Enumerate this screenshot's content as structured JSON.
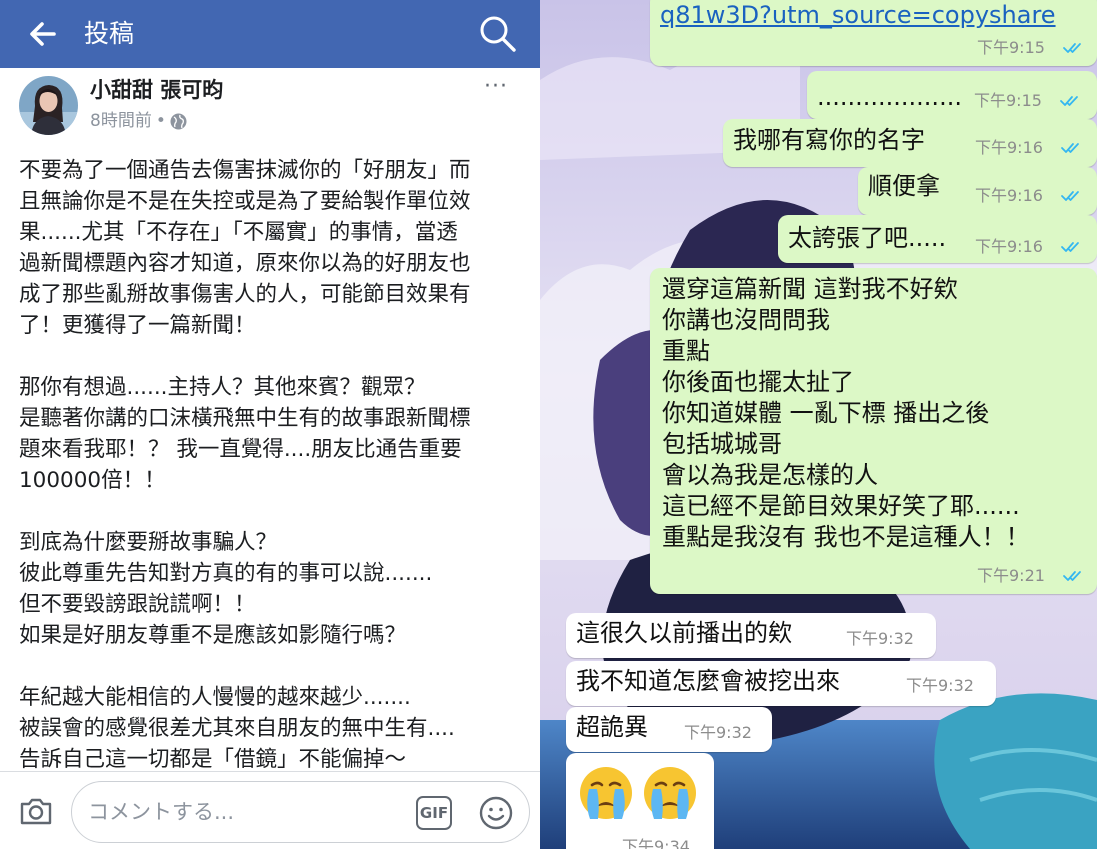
{
  "facebook": {
    "header": {
      "title": "投稿"
    },
    "post": {
      "author": "小甜甜 張可昀",
      "time": "8時間前",
      "separator": "•",
      "more": "···",
      "lines": [
        "不要為了一個通告去傷害抹滅你的「好朋友」而",
        "且無論你是不是在失控或是為了要給製作單位效",
        "果......尤其「不存在」「不屬實」的事情，當透",
        "過新聞標題內容才知道，原來你以為的好朋友也",
        "成了那些亂掰故事傷害人的人，可能節目效果有",
        "了！更獲得了一篇新聞！",
        "",
        "那你有想過......主持人？其他來賓？觀眾？",
        "是聽著你講的口沫橫飛無中生有的故事跟新聞標",
        "題來看我耶！？ 我一直覺得....朋友比通告重要",
        "100000倍！！",
        "",
        "到底為什麼要掰故事騙人？",
        "彼此尊重先告知對方真的有的事可以說.......",
        "但不要毀謗跟說謊啊！！",
        "如果是好朋友尊重不是應該如影隨行嗎？",
        "",
        "年紀越大能相信的人慢慢的越來越少.......",
        "被誤會的感覺很差尤其來自朋友的無中生有....",
        "告訴自己這一切都是「借鏡」不能偏掉～"
      ]
    },
    "comment": {
      "placeholder": "コメントする...",
      "gif_label": "GIF"
    }
  },
  "chat": {
    "messages": [
      {
        "dir": "out",
        "text": "q81w3D?utm_source=copyshare",
        "time": "下午9:15",
        "read": true,
        "link": true
      },
      {
        "dir": "out",
        "text": "...................",
        "time": "下午9:15",
        "read": true
      },
      {
        "dir": "out",
        "text": "我哪有寫你的名字",
        "time": "下午9:16",
        "read": true
      },
      {
        "dir": "out",
        "text": "順便拿",
        "time": "下午9:16",
        "read": true
      },
      {
        "dir": "out",
        "text": "太誇張了吧.....",
        "time": "下午9:16",
        "read": true
      },
      {
        "dir": "out",
        "lines": [
          "還穿這篇新聞 這對我不好欸",
          "你講也沒問問我",
          "重點",
          "你後面也擺太扯了",
          "你知道媒體 一亂下標 播出之後",
          "包括城城哥",
          "會以為我是怎樣的人",
          "這已經不是節目效果好笑了耶......",
          "重點是我沒有 我也不是這種人！！"
        ],
        "time": "下午9:21",
        "read": true
      },
      {
        "dir": "in",
        "text": "這很久以前播出的欸",
        "time": "下午9:32"
      },
      {
        "dir": "in",
        "text": "我不知道怎麼會被挖出來",
        "time": "下午9:32"
      },
      {
        "dir": "in",
        "text": "超詭異",
        "time": "下午9:32"
      },
      {
        "dir": "in",
        "emoji": [
          "crying-face",
          "crying-face"
        ],
        "time": "下午9:34"
      }
    ]
  },
  "colors": {
    "facebook_blue": "#4267b2",
    "outgoing_bubble": "#dcf8c6",
    "incoming_bubble": "#ffffff",
    "read_ticks": "#34b7f1",
    "link": "#1a62c0"
  }
}
